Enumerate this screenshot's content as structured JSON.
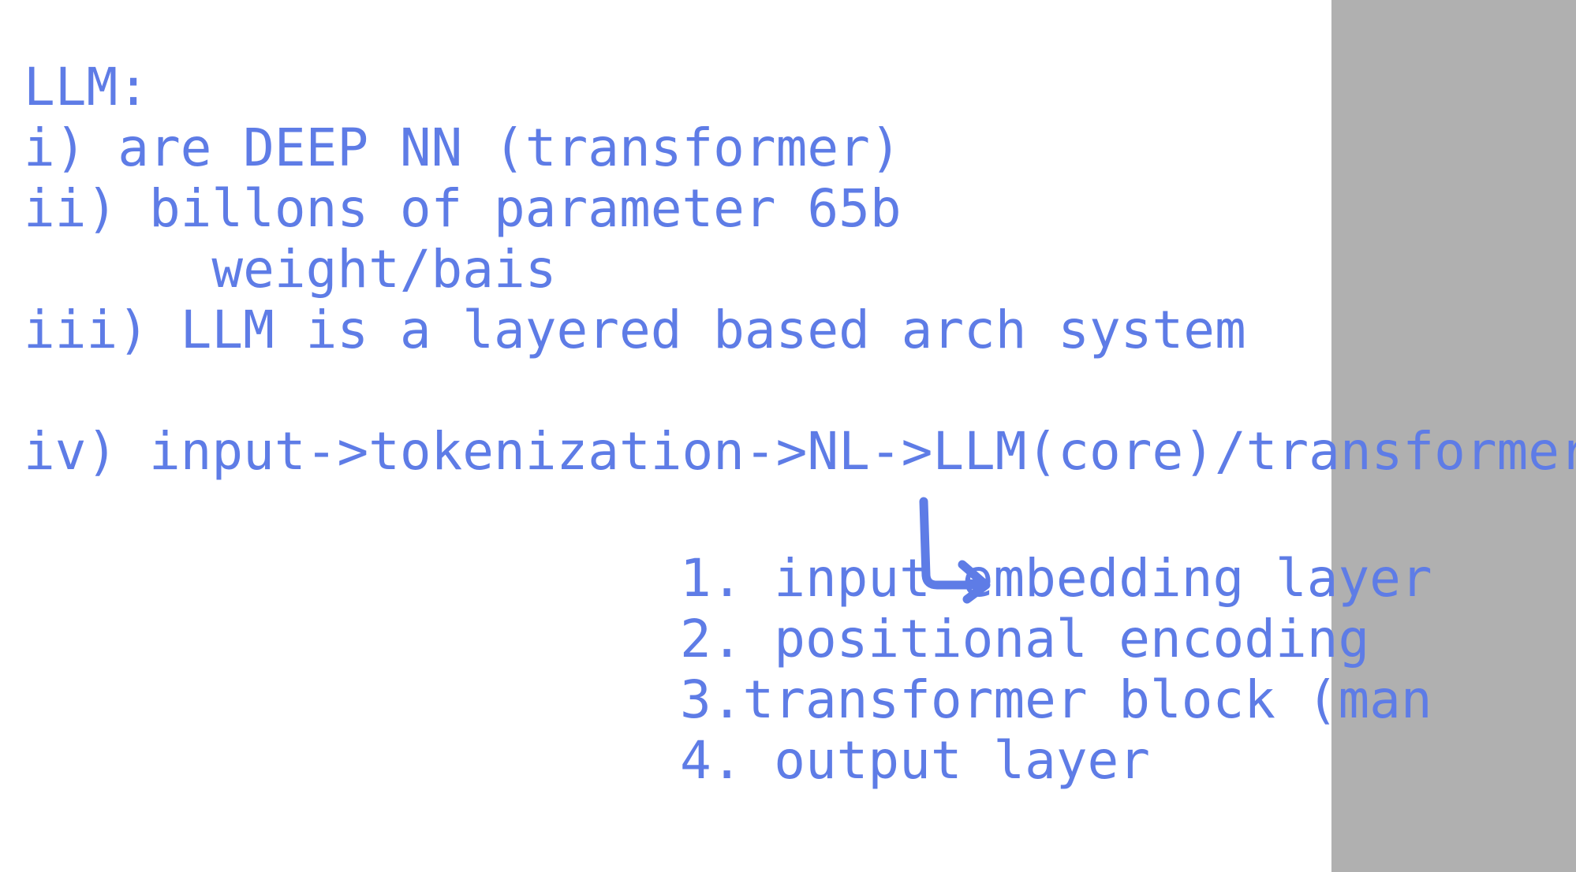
{
  "notes": {
    "heading": "LLM:",
    "point_1": "i) are DEEP NN (transformer)",
    "point_2": "ii) billons of parameter 65b",
    "point_2_sub": "      weight/bais",
    "point_3": "iii) LLM is a layered based arch system",
    "point_4": "iv) input->tokenization->NL->LLM(core)/transformer",
    "layers": [
      "1. input embedding layer",
      "2. positional encoding",
      "3.transformer block (man",
      "4. output layer"
    ]
  },
  "colors": {
    "ink": "#5e7ce6",
    "background": "#ffffff",
    "side_panel": "#b0b0b0"
  },
  "icons": {
    "connector": "curved-arrow-down-right-icon"
  }
}
